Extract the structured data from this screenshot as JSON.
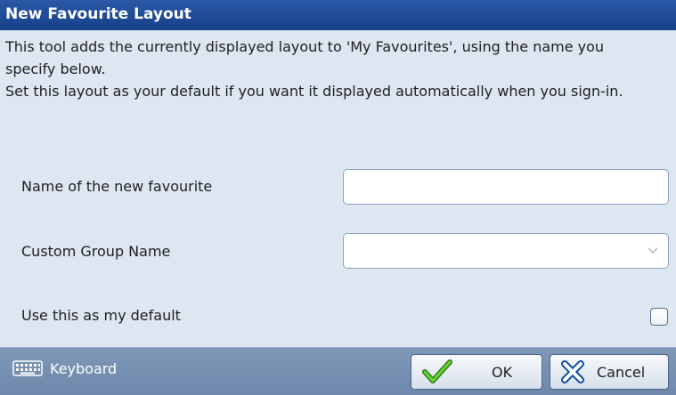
{
  "dialog": {
    "title": "New Favourite Layout",
    "description_line1": "This tool adds the currently displayed layout to 'My Favourites', using the name you specify below.",
    "description_line2": "Set this layout as your default if you want it displayed automatically when you sign-in."
  },
  "form": {
    "name_label": "Name of the new favourite",
    "name_value": "",
    "group_label": "Custom Group Name",
    "group_value": "",
    "default_label": "Use this as my default",
    "default_checked": false
  },
  "footer": {
    "keyboard_label": "Keyboard",
    "keyboard_icon": "keyboard-icon",
    "ok_label": "OK",
    "ok_icon": "checkmark-icon",
    "cancel_label": "Cancel",
    "cancel_icon": "cross-icon"
  },
  "colors": {
    "titlebar": "#1f4a95",
    "body_bg": "#dde6f1",
    "footer_bg": "#7790b3",
    "ok_check": "#3fae1c",
    "cancel_cross": "#1f6fd0"
  }
}
